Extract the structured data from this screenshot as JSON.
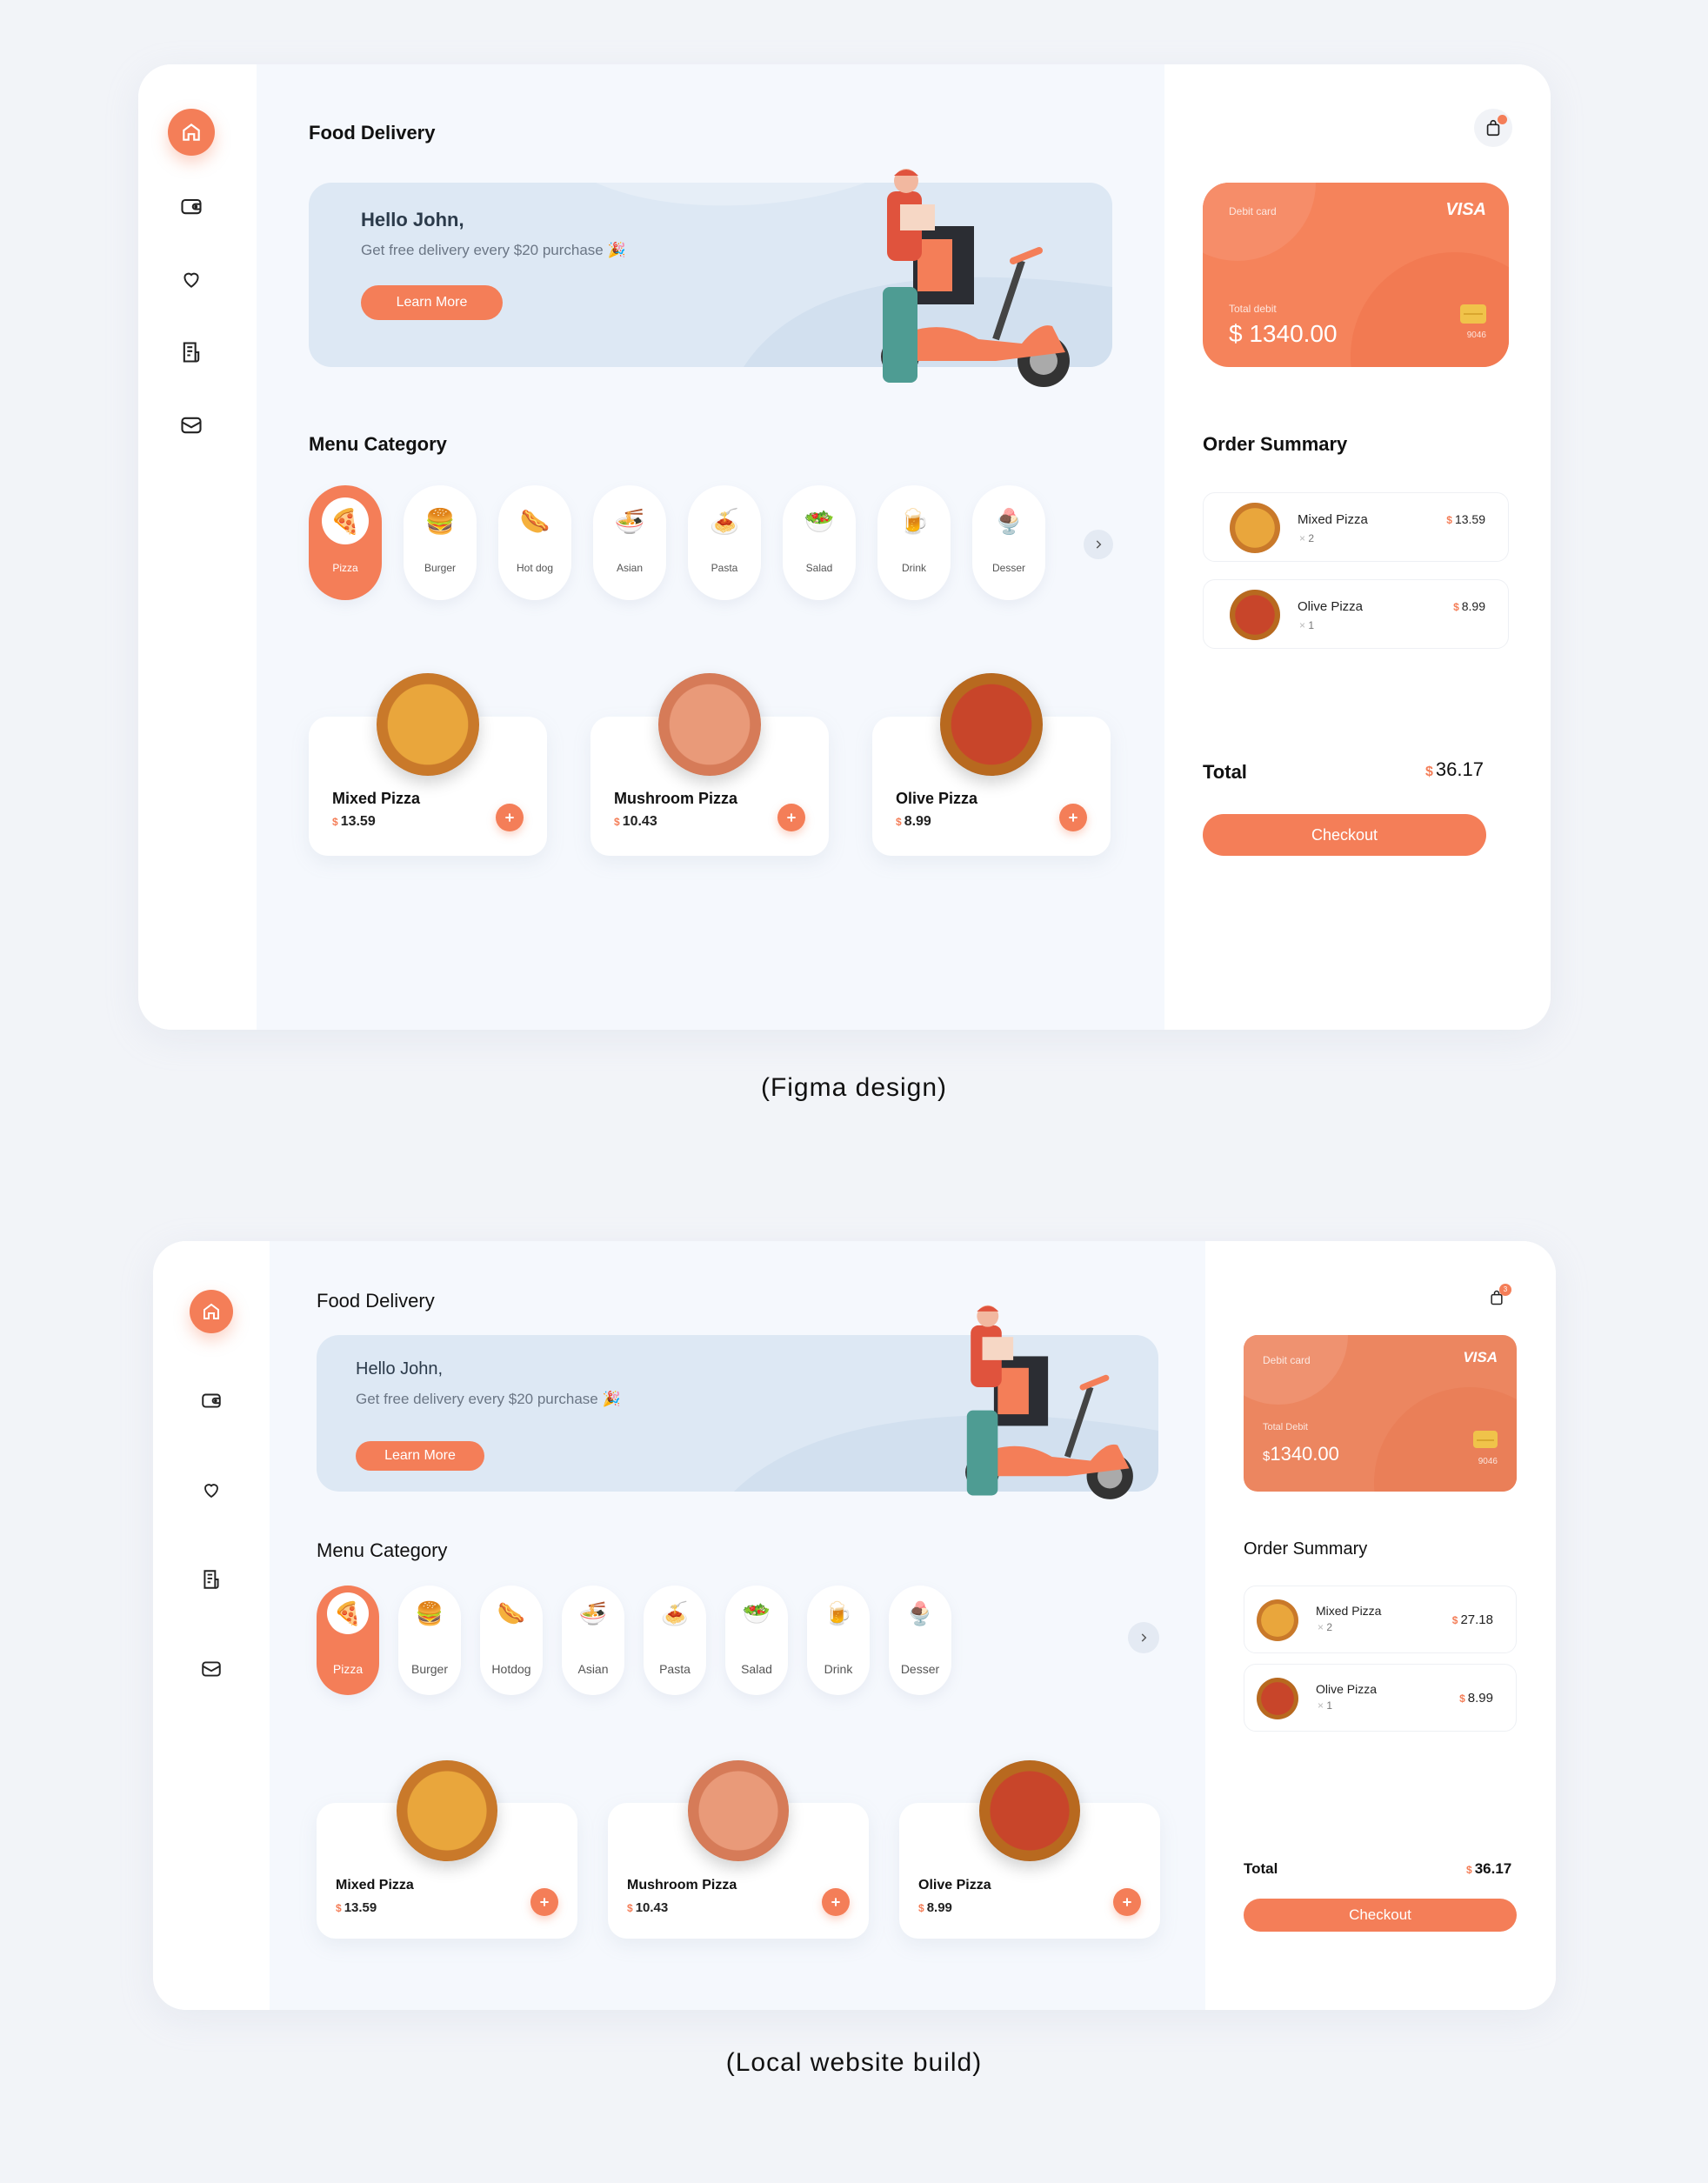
{
  "colors": {
    "accent": "#f47e58",
    "page_bg": "#f2f4f8",
    "main_bg": "#f5f8fd",
    "banner_bg": "#dde8f4"
  },
  "figma": {
    "caption": "(Figma design)",
    "title": "Food Delivery",
    "banner": {
      "greeting": "Hello John,",
      "subtitle": "Get free delivery every $20 purchase 🎉",
      "button": "Learn More"
    },
    "menu_title": "Menu Category",
    "categories": [
      {
        "label": "Pizza",
        "emoji": "🍕"
      },
      {
        "label": "Burger",
        "emoji": "🍔"
      },
      {
        "label": "Hot dog",
        "emoji": "🌭"
      },
      {
        "label": "Asian",
        "emoji": "🍜"
      },
      {
        "label": "Pasta",
        "emoji": "🍝"
      },
      {
        "label": "Salad",
        "emoji": "🥗"
      },
      {
        "label": "Drink",
        "emoji": "🍺"
      },
      {
        "label": "Desser",
        "emoji": "🍨"
      }
    ],
    "products": [
      {
        "name": "Mixed Pizza",
        "currency": "$",
        "price": "13.59"
      },
      {
        "name": "Mushroom Pizza",
        "currency": "$",
        "price": "10.43"
      },
      {
        "name": "Olive Pizza",
        "currency": "$",
        "price": "8.99"
      }
    ],
    "card": {
      "label": "Debit card",
      "brand": "VISA",
      "total_label": "Total debit",
      "amount": "$ 1340.00",
      "last4": "9046"
    },
    "order_title": "Order Summary",
    "orders": [
      {
        "name": "Mixed Pizza",
        "qty": "2",
        "currency": "$",
        "price": "13.59"
      },
      {
        "name": "Olive Pizza",
        "qty": "1",
        "currency": "$",
        "price": "8.99"
      }
    ],
    "total_label": "Total",
    "total_currency": "$",
    "total_value": "36.17",
    "checkout": "Checkout"
  },
  "local": {
    "caption": "(Local website build)",
    "title": "Food Delivery",
    "banner": {
      "greeting": "Hello John,",
      "subtitle": "Get free delivery every $20 purchase 🎉",
      "button": "Learn More"
    },
    "menu_title": "Menu Category",
    "categories": [
      {
        "label": "Pizza",
        "emoji": "🍕"
      },
      {
        "label": "Burger",
        "emoji": "🍔"
      },
      {
        "label": "Hotdog",
        "emoji": "🌭"
      },
      {
        "label": "Asian",
        "emoji": "🍜"
      },
      {
        "label": "Pasta",
        "emoji": "🍝"
      },
      {
        "label": "Salad",
        "emoji": "🥗"
      },
      {
        "label": "Drink",
        "emoji": "🍺"
      },
      {
        "label": "Desser",
        "emoji": "🍨"
      }
    ],
    "products": [
      {
        "name": "Mixed Pizza",
        "currency": "$",
        "price": "13.59"
      },
      {
        "name": "Mushroom Pizza",
        "currency": "$",
        "price": "10.43"
      },
      {
        "name": "Olive Pizza",
        "currency": "$",
        "price": "8.99"
      }
    ],
    "card": {
      "label": "Debit card",
      "brand": "VISA",
      "total_label": "Total Debit",
      "amount_currency": "$",
      "amount": "1340.00",
      "last4": "9046"
    },
    "cart_badge": "3",
    "order_title": "Order Summary",
    "orders": [
      {
        "name": "Mixed Pizza",
        "qty": "2",
        "currency": "$",
        "price": "27.18"
      },
      {
        "name": "Olive Pizza",
        "qty": "1",
        "currency": "$",
        "price": "8.99"
      }
    ],
    "total_label": "Total",
    "total_currency": "$",
    "total_value": "36.17",
    "checkout": "Checkout"
  }
}
